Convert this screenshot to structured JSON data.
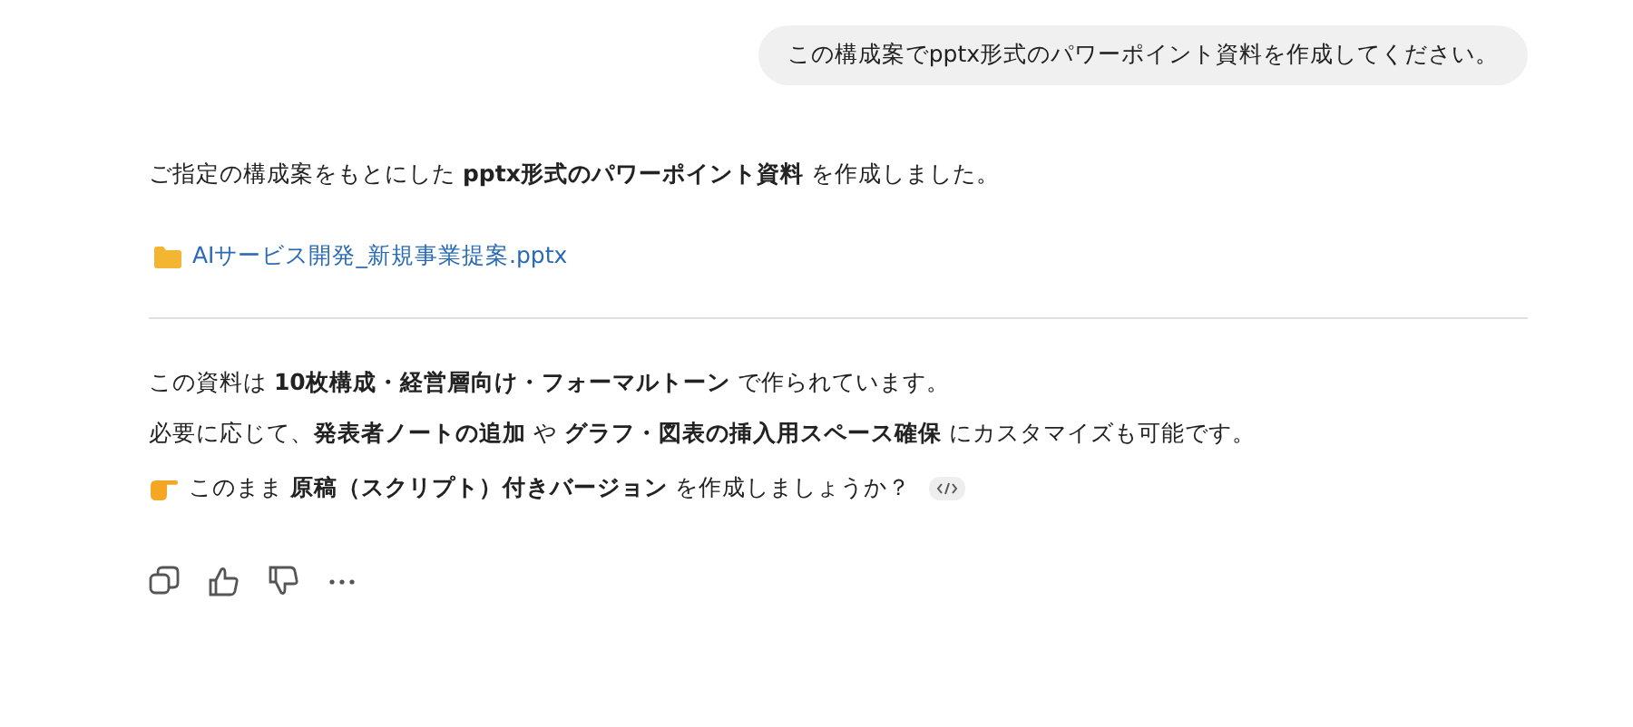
{
  "user_message": "この構成案でpptx形式のパワーポイント資料を作成してください。",
  "reply": {
    "intro": "ご指定の構成案をもとにした **pptx形式のパワーポイント資料** を作成しました。",
    "attachment": {
      "name": "AIサービス開発_新規事業提案.pptx"
    },
    "summary": [
      "この資料は **10枚構成・経営層向け・フォーマルトーン** で作られています。",
      "必要に応じて、**発表者ノートの追加** や **グラフ・図表の挿入用スペース確保** にカスタマイズも可能です。"
    ],
    "question": "このまま **原稿（スクリプト）付きバージョン** を作成しましょうか？"
  },
  "actions": [
    {
      "kind": "copy"
    },
    {
      "kind": "like"
    },
    {
      "kind": "dislike"
    },
    {
      "kind": "more"
    }
  ]
}
